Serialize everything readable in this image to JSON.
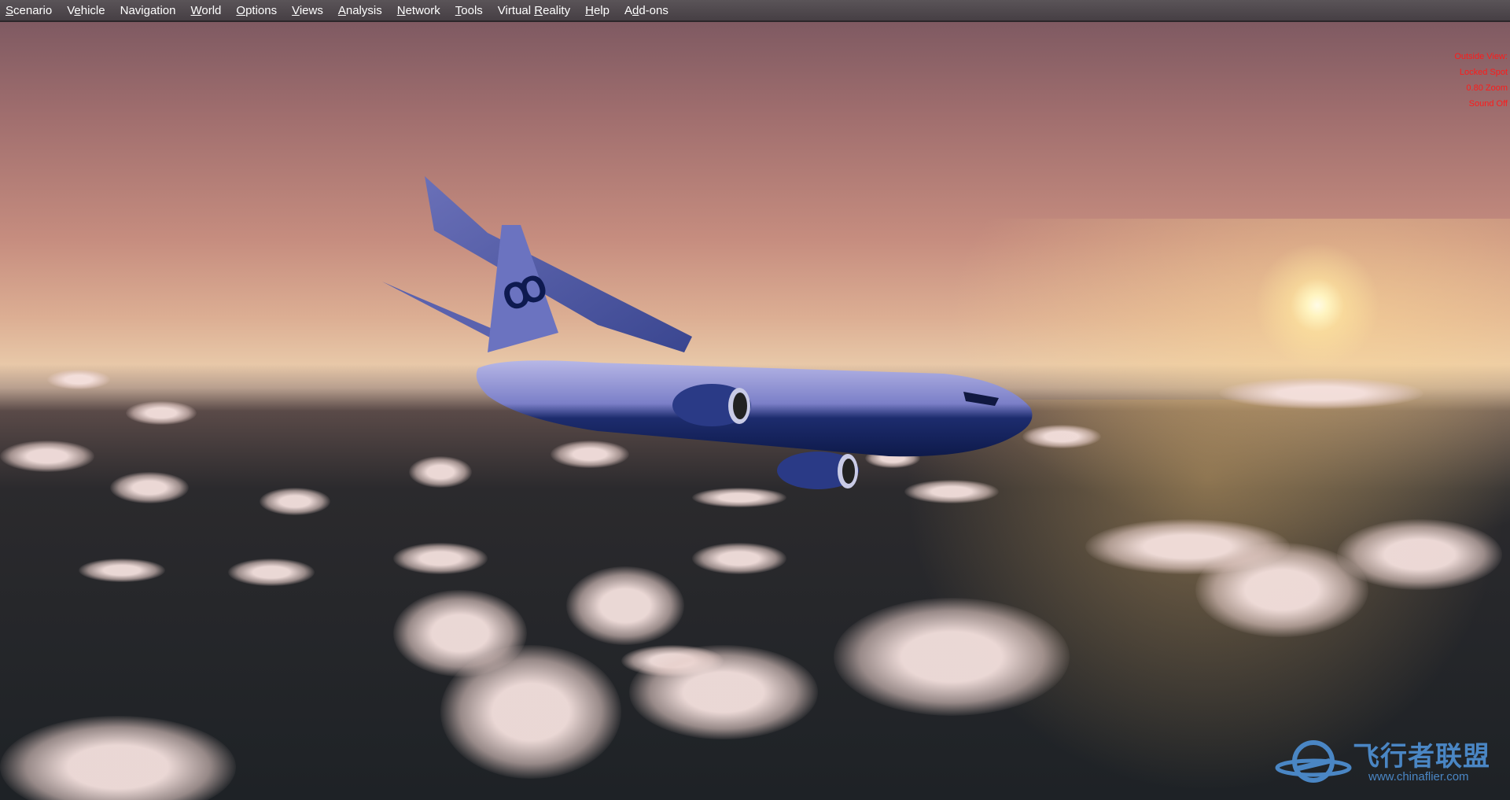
{
  "menu": {
    "items": [
      {
        "pre": "",
        "key": "S",
        "post": "cenario"
      },
      {
        "pre": "V",
        "key": "e",
        "post": "hicle"
      },
      {
        "pre": "Navi",
        "key": "g",
        "post": "ation"
      },
      {
        "pre": "",
        "key": "W",
        "post": "orld"
      },
      {
        "pre": "",
        "key": "O",
        "post": "ptions"
      },
      {
        "pre": "",
        "key": "V",
        "post": "iews"
      },
      {
        "pre": "",
        "key": "A",
        "post": "nalysis"
      },
      {
        "pre": "",
        "key": "N",
        "post": "etwork"
      },
      {
        "pre": "",
        "key": "T",
        "post": "ools"
      },
      {
        "pre": "Virtual ",
        "key": "R",
        "post": "eality"
      },
      {
        "pre": "",
        "key": "H",
        "post": "elp"
      },
      {
        "pre": "A",
        "key": "d",
        "post": "d-ons"
      }
    ]
  },
  "hud": {
    "lines": [
      "Outside View:",
      "Locked Spot",
      "0.80 Zoom",
      "Sound Off"
    ],
    "color": "#ff1a1a"
  },
  "watermark": {
    "title": "飞行者联盟",
    "url": "www.chinaflier.com",
    "color": "#4a86c4"
  }
}
